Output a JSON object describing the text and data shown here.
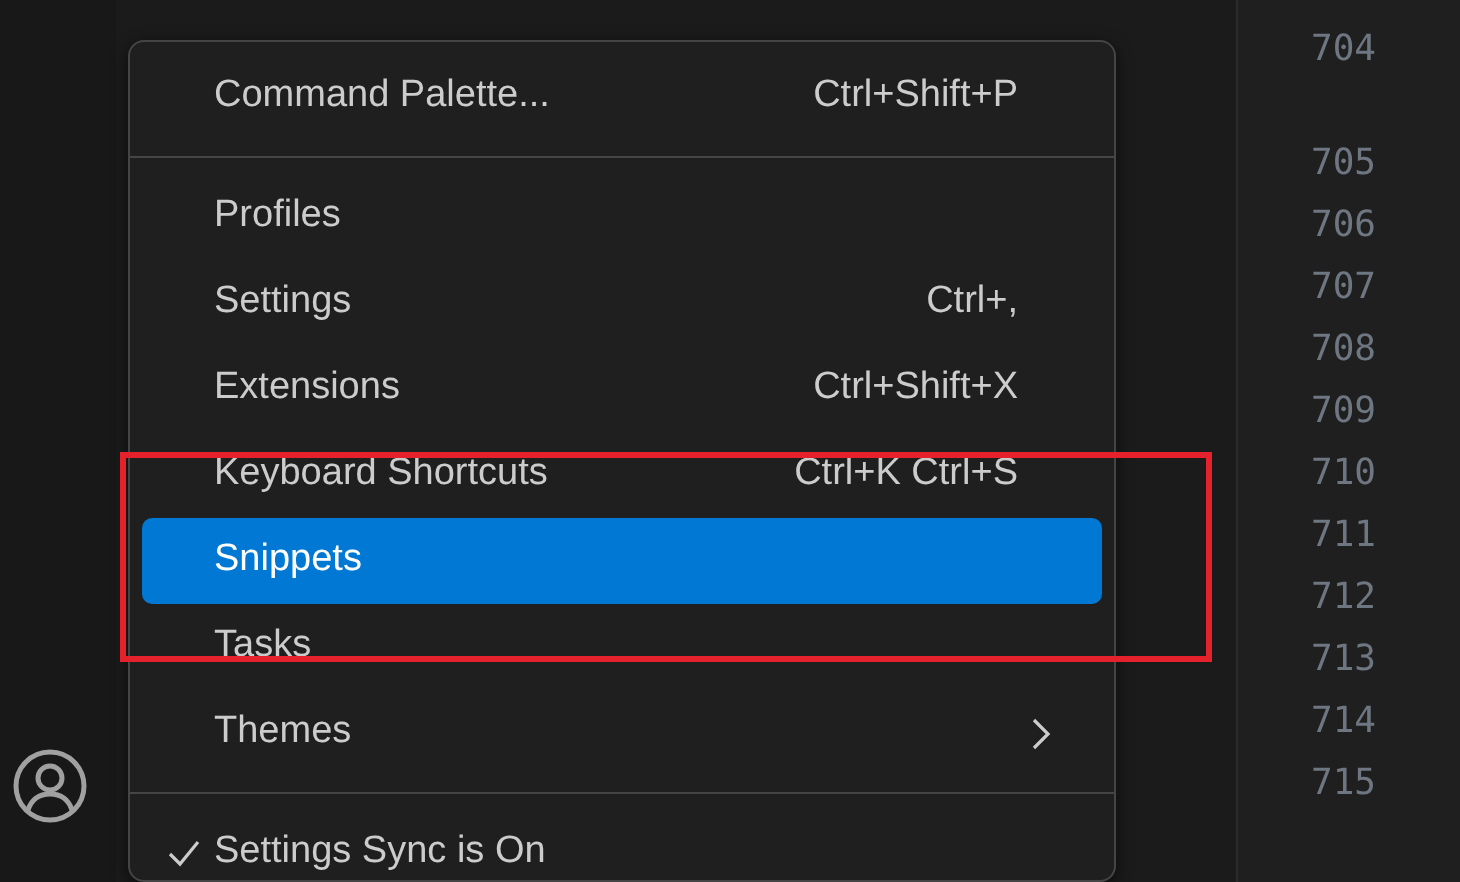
{
  "menu": {
    "groups": [
      {
        "items": [
          {
            "kind": "command",
            "label": "Command Palette...",
            "shortcut": "Ctrl+Shift+P",
            "selected": false
          }
        ]
      },
      {
        "items": [
          {
            "kind": "command",
            "label": "Profiles",
            "selected": false
          },
          {
            "kind": "command",
            "label": "Settings",
            "shortcut": "Ctrl+,",
            "selected": false
          },
          {
            "kind": "command",
            "label": "Extensions",
            "shortcut": "Ctrl+Shift+X",
            "selected": false
          },
          {
            "kind": "command",
            "label": "Keyboard Shortcuts",
            "shortcut": "Ctrl+K Ctrl+S",
            "selected": false
          },
          {
            "kind": "command",
            "label": "Snippets",
            "selected": true
          },
          {
            "kind": "command",
            "label": "Tasks",
            "selected": false
          },
          {
            "kind": "submenu",
            "label": "Themes",
            "selected": false
          }
        ]
      },
      {
        "items": [
          {
            "kind": "toggle",
            "label": "Settings Sync is On",
            "checked": true,
            "selected": false
          }
        ]
      }
    ]
  },
  "editor": {
    "line_numbers": [
      {
        "number": "704",
        "wrapped": true
      },
      {
        "number": "705",
        "wrapped": false
      },
      {
        "number": "706",
        "wrapped": false
      },
      {
        "number": "707",
        "wrapped": false
      },
      {
        "number": "708",
        "wrapped": false
      },
      {
        "number": "709",
        "wrapped": false
      },
      {
        "number": "710",
        "wrapped": false
      },
      {
        "number": "711",
        "wrapped": false
      },
      {
        "number": "712",
        "wrapped": false
      },
      {
        "number": "713",
        "wrapped": false
      },
      {
        "number": "714",
        "wrapped": false
      },
      {
        "number": "715",
        "wrapped": false
      }
    ]
  }
}
